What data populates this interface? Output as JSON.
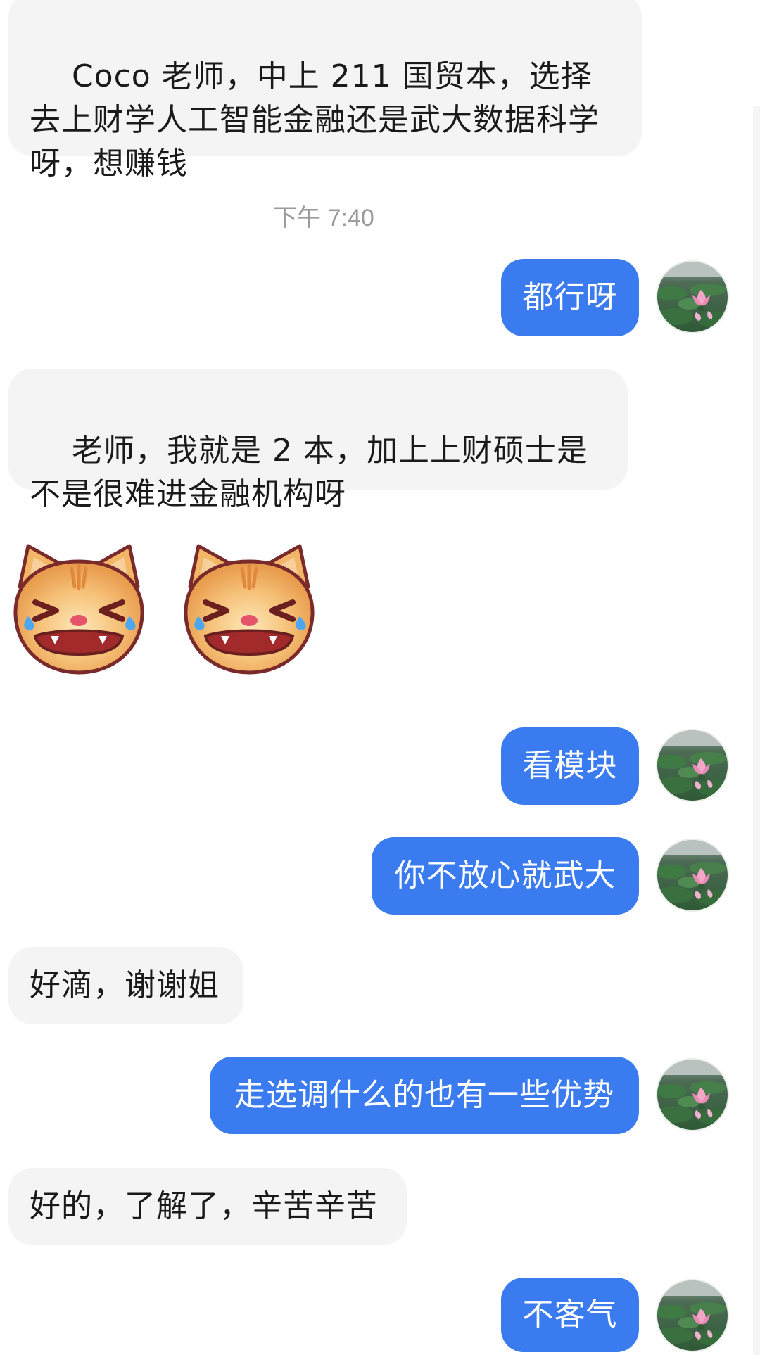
{
  "conversation": {
    "timestamp": "下午 7:40",
    "messages": [
      {
        "id": 1,
        "direction": "incoming",
        "type": "text",
        "text": "Coco 老师，中上 211 国贸本，选择去上财学人工智能金融还是武大数据科学呀，想赚钱"
      },
      {
        "id": 2,
        "direction": "outgoing",
        "type": "text",
        "text": "都行呀"
      },
      {
        "id": 3,
        "direction": "incoming",
        "type": "text",
        "text": "老师，我就是 2 本，加上上财硕士是不是很难进金融机构呀"
      },
      {
        "id": 4,
        "direction": "incoming",
        "type": "sticker",
        "sticker": "crying-cat-face",
        "count": 2
      },
      {
        "id": 5,
        "direction": "outgoing",
        "type": "text",
        "text": "看模块"
      },
      {
        "id": 6,
        "direction": "outgoing",
        "type": "text",
        "text": "你不放心就武大"
      },
      {
        "id": 7,
        "direction": "incoming",
        "type": "text",
        "text": "好滴，谢谢姐"
      },
      {
        "id": 8,
        "direction": "outgoing",
        "type": "text",
        "text": "走选调什么的也有一些优势"
      },
      {
        "id": 9,
        "direction": "incoming",
        "type": "text",
        "text": "好的，了解了，辛苦辛苦"
      },
      {
        "id": 10,
        "direction": "outgoing",
        "type": "text",
        "text": "不客气"
      }
    ]
  },
  "avatar": {
    "icon": "lotus-pond-avatar",
    "subject": "lotus flower in pond"
  },
  "colors": {
    "outgoing_bubble": "#3b7bf0",
    "incoming_bubble": "#f4f4f4",
    "timestamp_text": "#9a9a9a"
  }
}
